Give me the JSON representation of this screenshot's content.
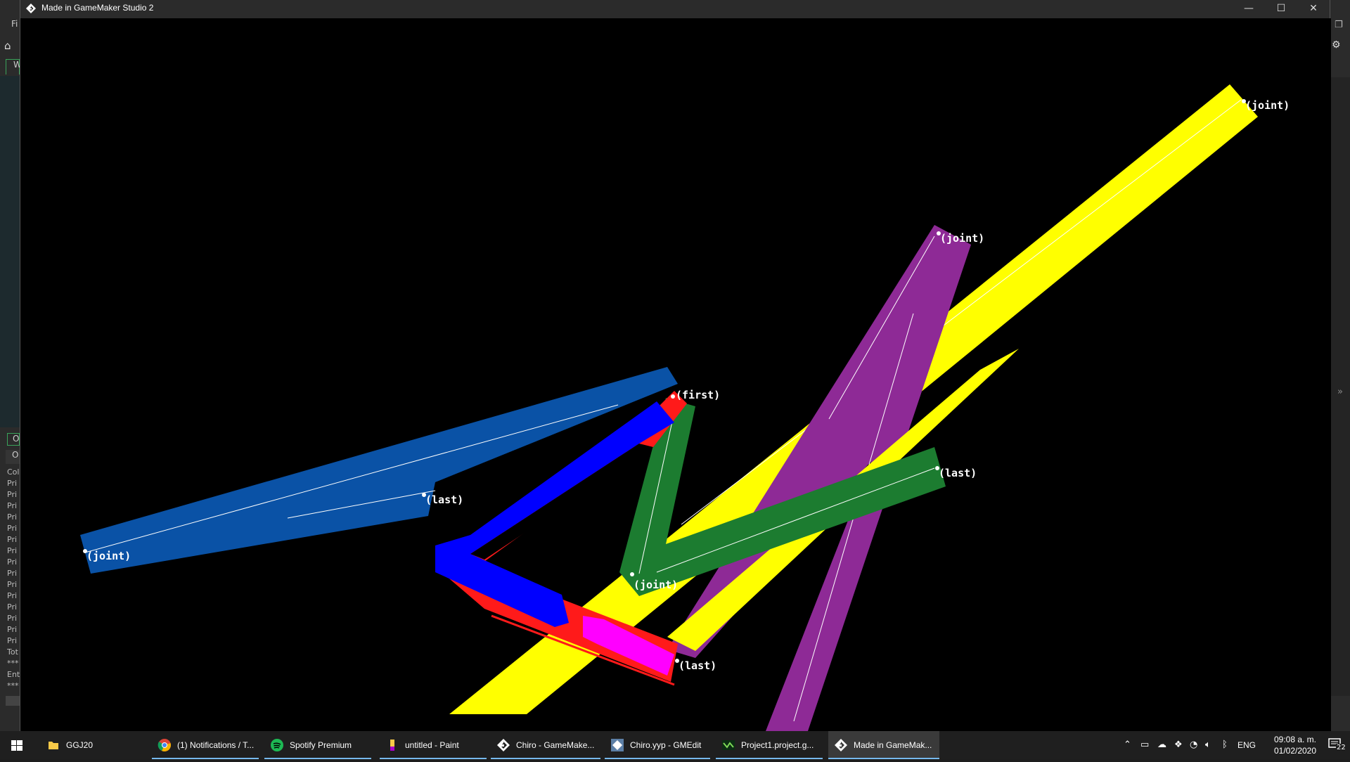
{
  "ide_background": {
    "file_menu_fragment": "Fi",
    "tab_fragment": "W",
    "output_tab_fragment": "O",
    "output_tab2_fragment": "O",
    "output_lines": [
      "Col",
      "Pri",
      "Pri",
      "Pri",
      "Pri",
      "Pri",
      "Pri",
      "Pri",
      "Pri",
      "Pri",
      "Pri",
      "Pri",
      "Pri",
      "Pri",
      "Pri",
      "Pri",
      "Tot",
      "***",
      "Ent",
      "***"
    ]
  },
  "window": {
    "title": "Made in GameMaker Studio 2",
    "minimize_glyph": "—",
    "maximize_glyph": "☐",
    "close_glyph": "✕",
    "app_icon": "gamemaker-icon"
  },
  "game": {
    "colors": {
      "background": "#000000",
      "yellow_limb": "#ffff00",
      "purple_limb": "#8e2a96",
      "light_blue_limb": "#0a52a6",
      "blue_limb": "#0000ff",
      "green_limb": "#1c7c30",
      "red_outline": "#ff1a1a",
      "magenta_tip": "#ff00ff",
      "label": "#ffffff"
    },
    "labels": {
      "yellow_joint": "(joint)",
      "purple_joint": "(joint)",
      "blue_first": "(first)",
      "green_last": "(last)",
      "lightblue_last": "(last)",
      "lightblue_joint": "(joint)",
      "green_joint": "(joint)",
      "blue_last": "(last)"
    }
  },
  "taskbar": {
    "items": [
      {
        "label": "GGJ20",
        "icon": "folder-icon"
      },
      {
        "label": "(1) Notifications / T...",
        "icon": "chrome-icon"
      },
      {
        "label": "Spotify Premium",
        "icon": "spotify-icon"
      },
      {
        "label": "untitled - Paint",
        "icon": "paint-icon"
      },
      {
        "label": "Chiro - GameMake...",
        "icon": "gamemaker-icon"
      },
      {
        "label": "Chiro.yyp - GMEdit",
        "icon": "gmedit-icon"
      },
      {
        "label": "Project1.project.g...",
        "icon": "project-icon"
      },
      {
        "label": "Made in GameMak...",
        "icon": "gamemaker-icon"
      }
    ],
    "tray": {
      "language": "ENG",
      "time": "09:08 a. m.",
      "date": "01/02/2020",
      "notification_count": "22"
    }
  }
}
